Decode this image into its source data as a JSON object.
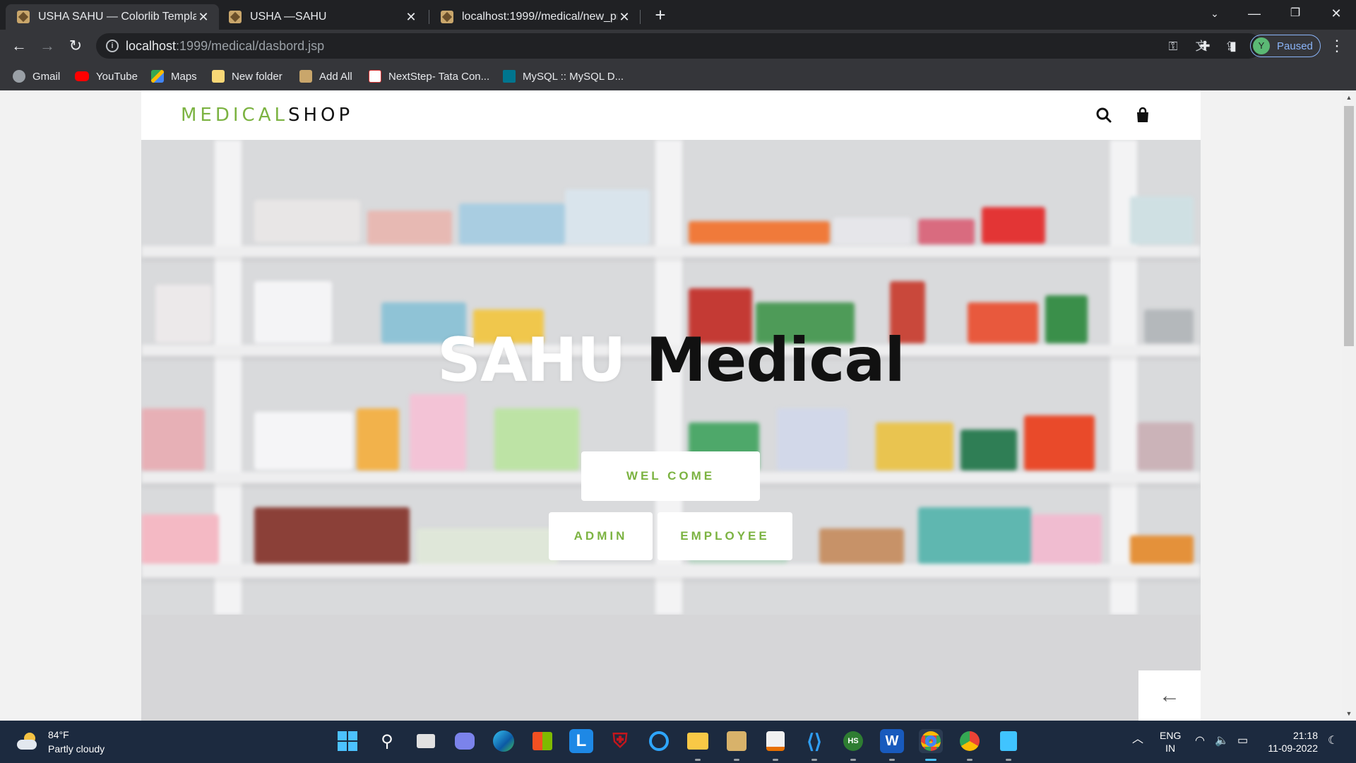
{
  "browser": {
    "tabs": [
      {
        "label": "USHA SAHU — Colorlib Template",
        "active": true
      },
      {
        "label": "USHA —SAHU",
        "active": false
      },
      {
        "label": "localhost:1999//medical/new_pro",
        "active": false
      }
    ],
    "url_host": "localhost",
    "url_path": ":1999/medical/dasbord.jsp",
    "profile_initial": "Y",
    "profile_status": "Paused",
    "bookmarks": [
      "Gmail",
      "YouTube",
      "Maps",
      "New folder",
      "Add All",
      "NextStep- Tata Con...",
      "MySQL :: MySQL D..."
    ]
  },
  "site": {
    "logo_part1": "MEDICAL",
    "logo_part2": "SHOP",
    "hero_title_white": "SAHU",
    "hero_title_dark": "Medical",
    "welcome_button": "WEL COME",
    "admin_button": "ADMIN",
    "employee_button": "EMPLOYEE",
    "accent_color": "#7cb342"
  },
  "taskbar": {
    "weather_temp": "84°F",
    "weather_desc": "Partly cloudy",
    "lang_line1": "ENG",
    "lang_line2": "IN",
    "time": "21:18",
    "date": "11-09-2022"
  }
}
